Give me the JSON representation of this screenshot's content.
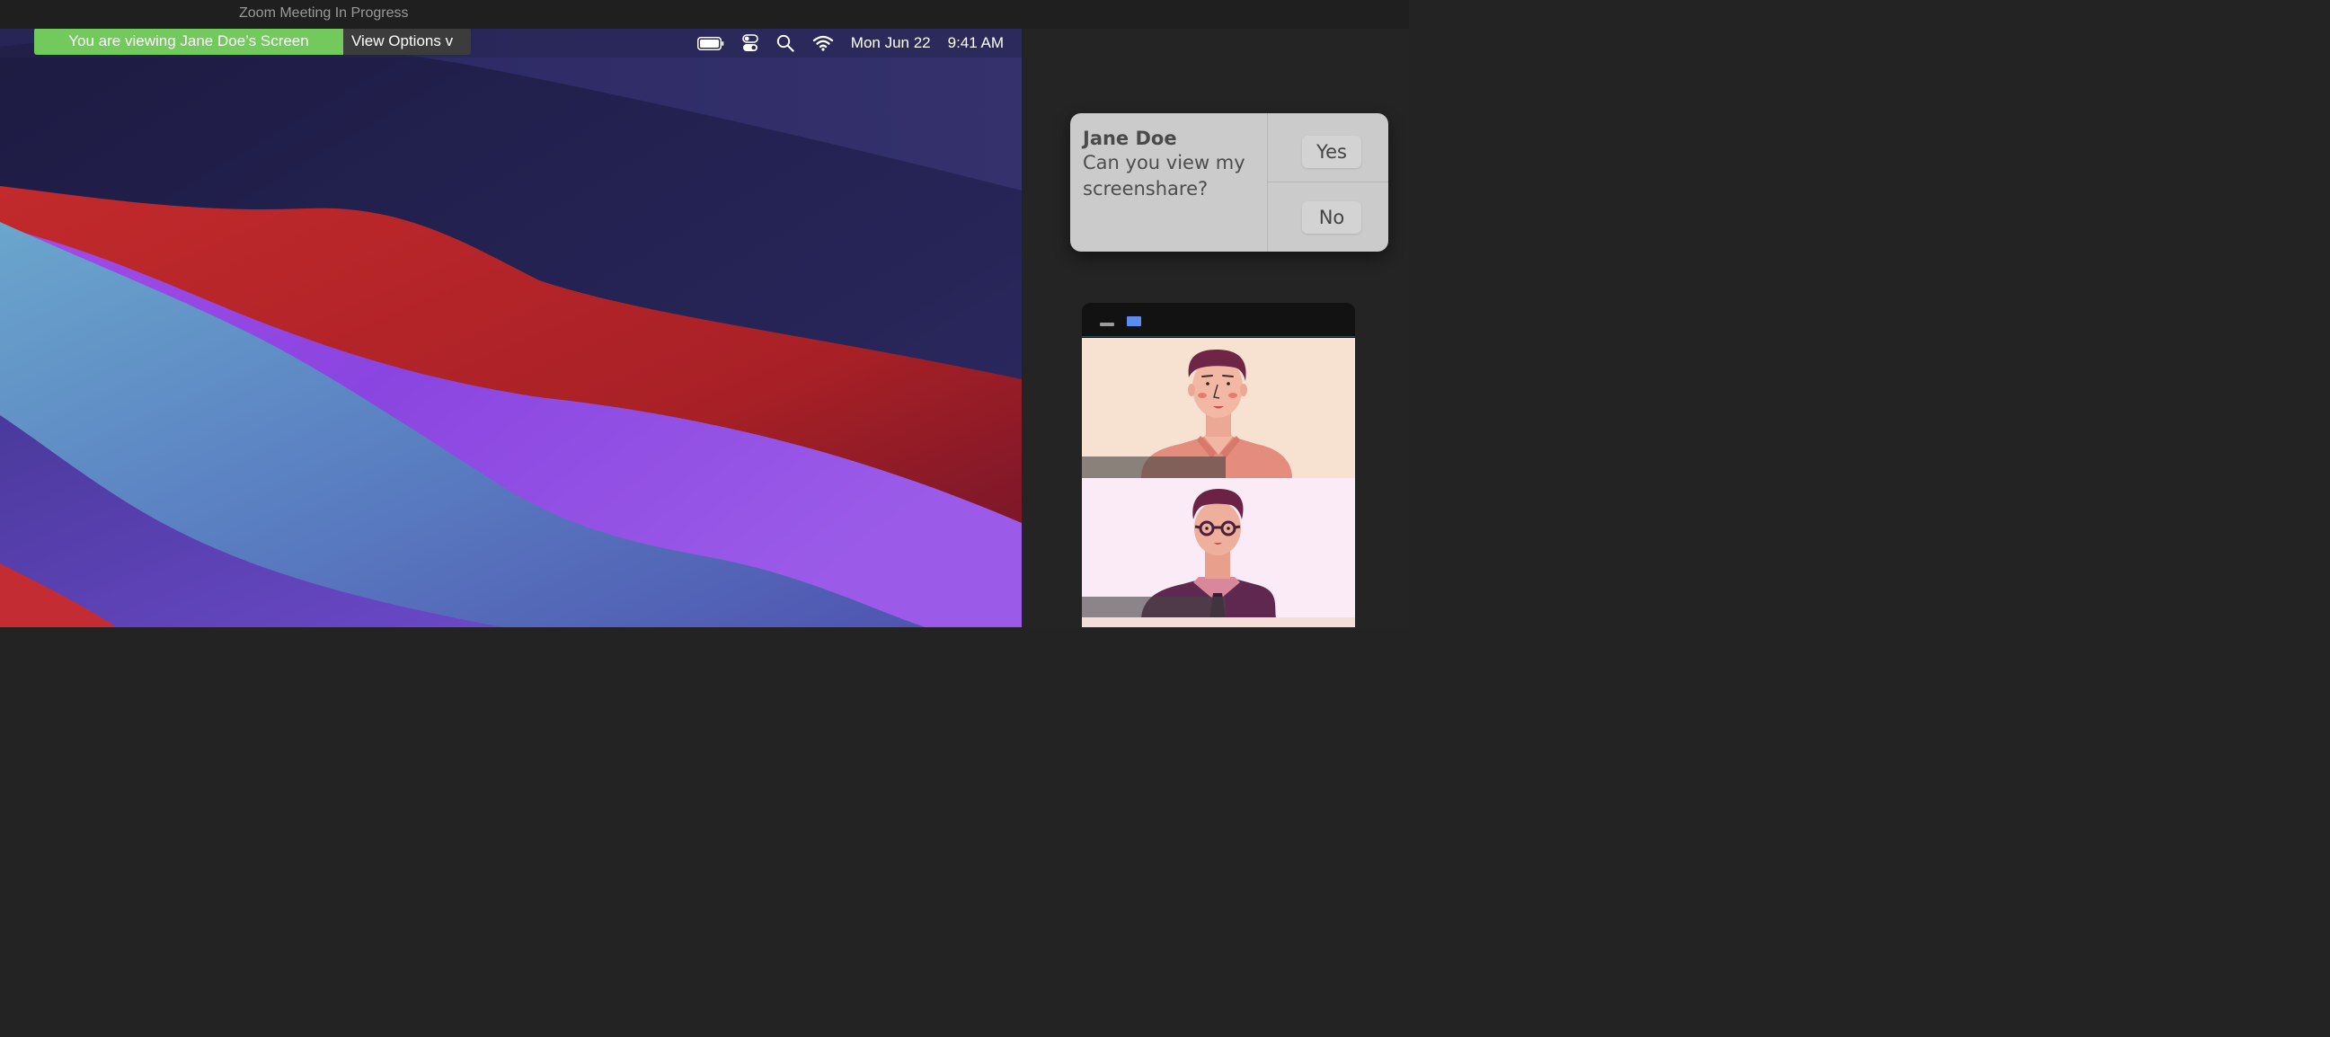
{
  "window": {
    "title": "Zoom Meeting In Progress"
  },
  "share_banner": {
    "viewing_text": "You are viewing Jane Doe’s Screen",
    "options_label": "View Options v"
  },
  "menubar": {
    "date": "Mon Jun 22",
    "time": "9:41 AM",
    "icons": [
      "battery-icon",
      "control-center-icon",
      "search-icon",
      "wifi-icon"
    ]
  },
  "notification": {
    "sender": "Jane Doe",
    "message": "Can you view my screenshare?",
    "yes_label": "Yes",
    "no_label": "No"
  },
  "gallery": {
    "controls": [
      "minimize-icon",
      "gallery-view-icon"
    ],
    "participants": [
      {
        "avatar": "man-avatar",
        "background": "#f7e1d0"
      },
      {
        "avatar": "man-with-glasses-avatar",
        "background": "#fbebf7"
      }
    ]
  },
  "colors": {
    "banner_green": "#72c95c",
    "accent_blue": "#5b8def",
    "notification_bg": "#cbcbcb"
  }
}
